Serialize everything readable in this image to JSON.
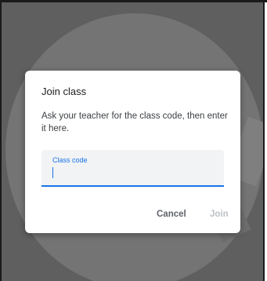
{
  "dialog": {
    "title": "Join class",
    "description": "Ask your teacher for the class code, then enter it here.",
    "field": {
      "label": "Class code",
      "value": ""
    },
    "buttons": {
      "cancel_label": "Cancel",
      "join_label": "Join"
    }
  },
  "colors": {
    "accent": "#1a73e8",
    "overlay": "#5f5f5f",
    "disabled_text": "#bdc1c6"
  }
}
